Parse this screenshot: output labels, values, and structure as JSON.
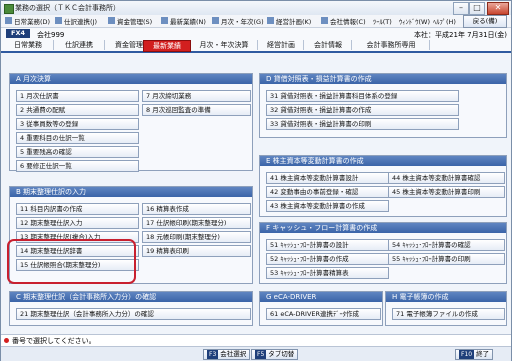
{
  "window": {
    "title": "業務の選択（ＴＫＣ会計事務所）"
  },
  "menu": {
    "items": [
      "日常業務(D)",
      "仕訳連携(J)",
      "資金管理(S)",
      "最新業績(N)",
      "月次・年次(G)",
      "経営計画(K)",
      "会社情報(C)",
      "ﾂｰﾙ(T)",
      "ｳｨﾝﾄﾞｳ(W)",
      "ﾍﾙﾌﾟ(H)"
    ],
    "back_label": "戻る(備)"
  },
  "info": {
    "system": "FX4",
    "company": "会社999",
    "branch": "本社：平成21年 7月31日(金)"
  },
  "tabs": [
    "日常業務",
    "仕訳連携",
    "資金管理",
    "最新業績",
    "月次・年次決算",
    "経営計画",
    "会計情報",
    "会計事務所専用"
  ],
  "active_tab_index": 3,
  "panels": {
    "A": {
      "title": "A 月次決算",
      "items": [
        "1 月次仕訳書",
        "2 共通費の配賦",
        "3 従事員数等の登録",
        "4 重要科目の仕訳一覧",
        "5 重要残高の確認",
        "6 要修正仕訳一覧",
        "7 月次締切業務",
        "8 月次巡回監査の準備"
      ]
    },
    "B": {
      "title": "B 期末整理仕訳の入力",
      "items": [
        "11 科目内訳書の作成",
        "12 期末整理仕訳入力",
        "13 期末整理仕訳(複合)入力",
        "14 期末整理仕訳辞書",
        "15 仕訳帳照合(期末整理分)",
        "16 精算表作成",
        "17 仕訳帳印刷(期末整理分)",
        "18 元帳印刷(期末整理分)",
        "19 精算表印刷"
      ]
    },
    "C": {
      "title": "C 期末整理仕訳（会計事務所入力分）の確認",
      "items": [
        "21 期末整理仕訳（会計事務所入力分）の確認"
      ]
    },
    "D": {
      "title": "D 貸借対照表・損益計算書の作成",
      "items": [
        "31 貸借対照表・損益計算書科目体系の登録",
        "32 貸借対照表・損益計算書の作成",
        "33 貸借対照表・損益計算書の印刷"
      ]
    },
    "E": {
      "title": "E 株主資本等変動計算書の作成",
      "items": [
        "41 株主資本等変動計算書設計",
        "42 変動事由の事前登録・確認",
        "43 株主資本等変動計算書の作成",
        "44 株主資本等変動計算書確認",
        "45 株主資本等変動計算書印刷"
      ]
    },
    "F": {
      "title": "F キャッシュ・フロー計算書の作成",
      "items": [
        "51 ｷｬｯｼｭ･ﾌﾛｰ計算書の設計",
        "52 ｷｬｯｼｭ･ﾌﾛｰ計算書の作成",
        "53 ｷｬｯｼｭ･ﾌﾛｰ計算書精算表",
        "54 ｷｬｯｼｭ･ﾌﾛｰ計算書の確認",
        "55 ｷｬｯｼｭ･ﾌﾛｰ計算書の印刷"
      ]
    },
    "G": {
      "title": "G eCA-DRIVER",
      "items": [
        "61 eCA-DRIVER連携ﾃﾞｰﾀ作成"
      ]
    },
    "H": {
      "title": "H 電子帳簿の作成",
      "items": [
        "71 電子帳簿ファイルの作成"
      ]
    }
  },
  "status": {
    "text": "番号で選択してください。"
  },
  "bottom": {
    "key1": "F3",
    "label1": "会社選択",
    "key2": "F5",
    "label2": "タブ切替",
    "key3": "F10",
    "label3": "終了"
  }
}
